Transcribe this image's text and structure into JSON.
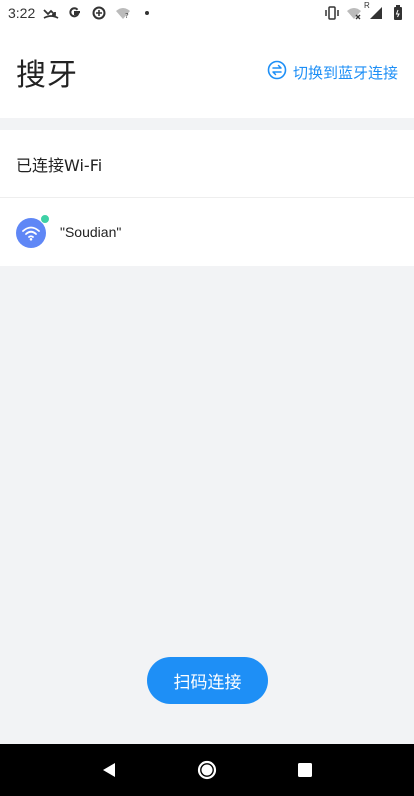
{
  "status_bar": {
    "time": "3:22",
    "left_icons": [
      "missed-call-icon",
      "google-icon",
      "data-saver-icon",
      "wifi-question-icon",
      "dot-icon"
    ],
    "right_icons": [
      "vibrate-icon",
      "wifi-off-icon",
      "signal-icon",
      "battery-icon"
    ],
    "roaming_label": "R"
  },
  "header": {
    "title": "搜牙",
    "switch_link_label": "切换到蓝牙连接"
  },
  "section": {
    "title": "已连接Wi-Fi",
    "wifi": {
      "name": "\"Soudian\""
    }
  },
  "actions": {
    "scan_button_label": "扫码连接"
  },
  "colors": {
    "accent": "#1e8ff6",
    "avatar_bg": "#5f87f6",
    "online_dot": "#3ed1a6",
    "background": "#f2f3f5"
  }
}
